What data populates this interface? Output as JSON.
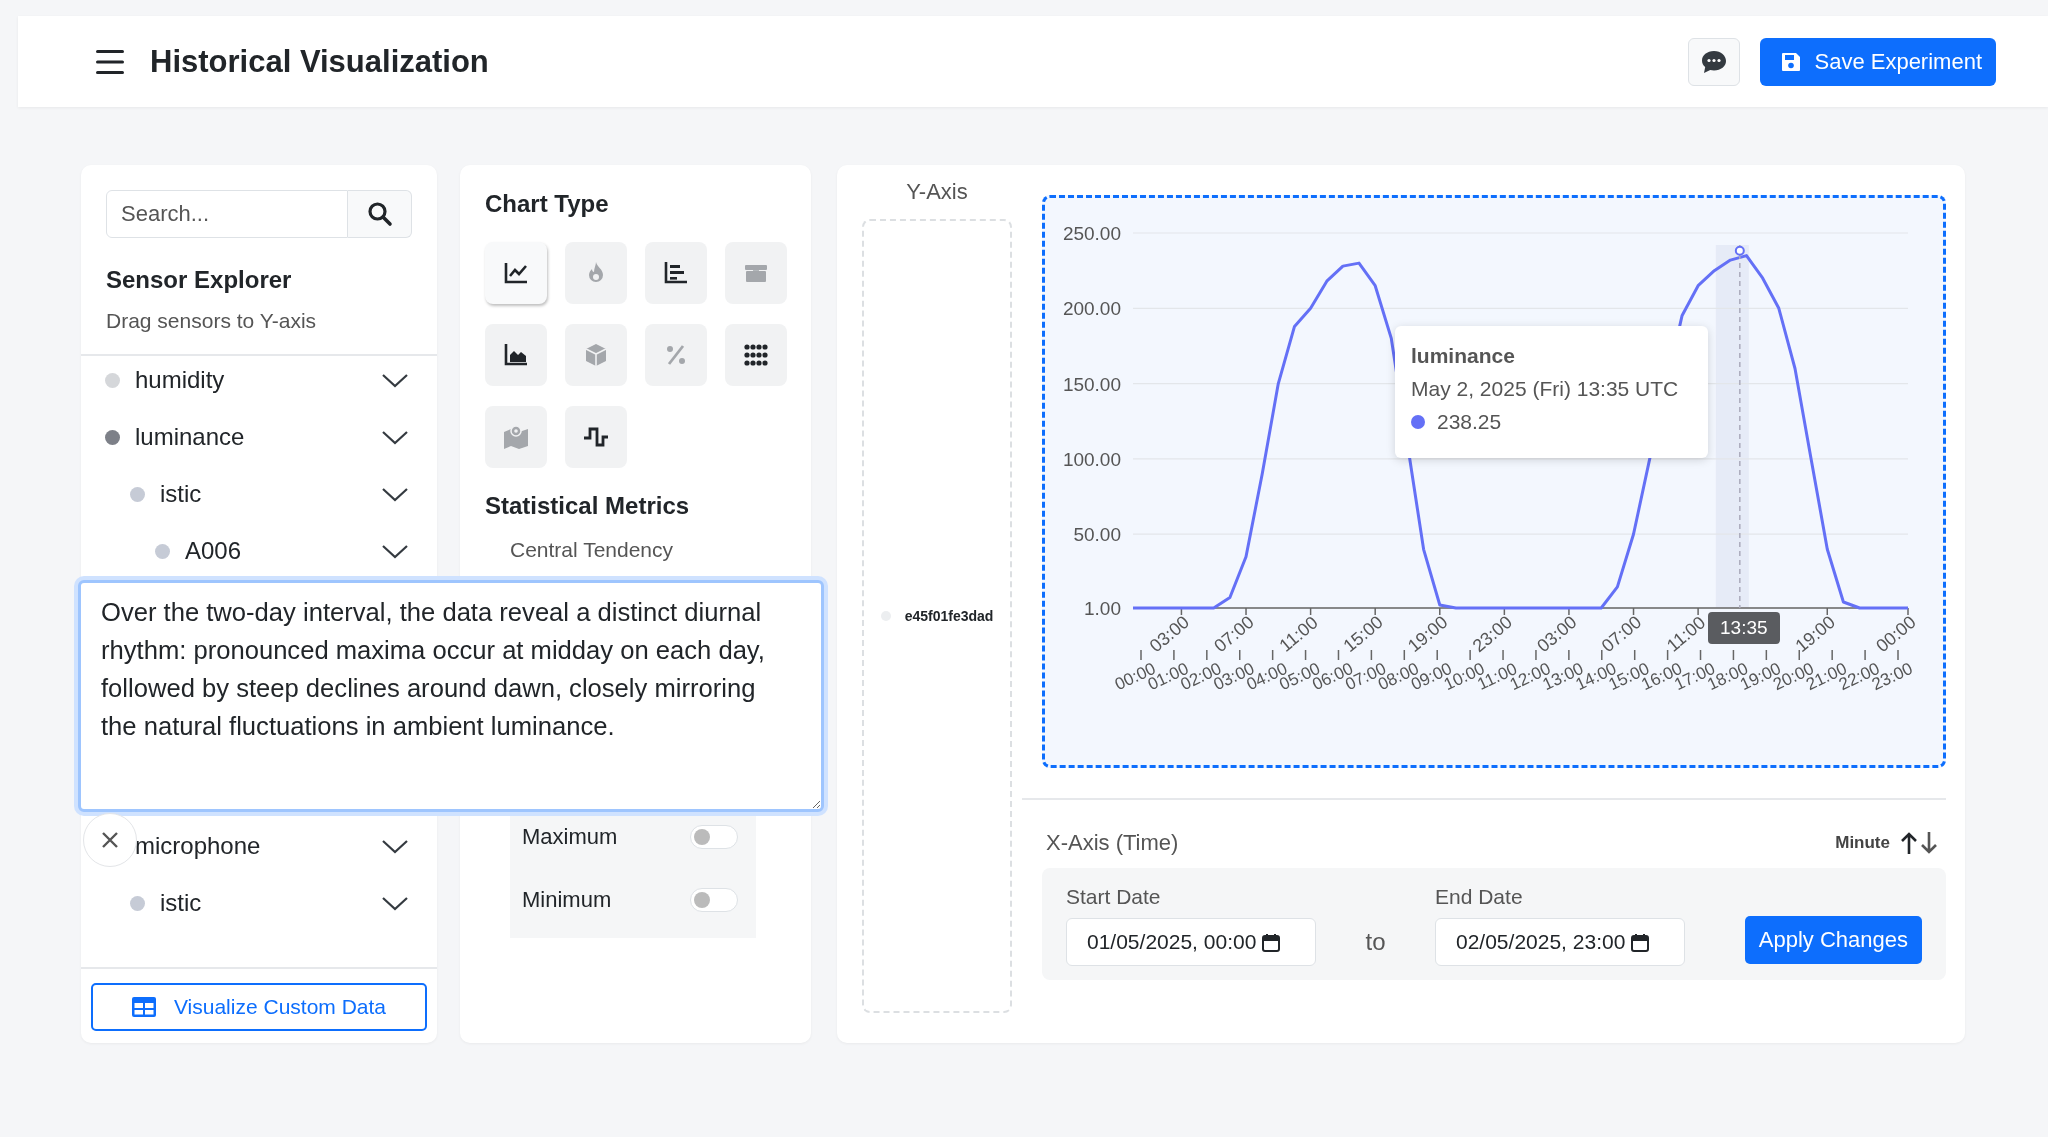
{
  "header": {
    "title": "Historical Visualization",
    "save_button": "Save Experiment"
  },
  "sensor_explorer": {
    "search": {
      "placeholder": "Search..."
    },
    "title": "Sensor Explorer",
    "subtitle": "Drag sensors to Y-axis",
    "tree": [
      {
        "label": "humidity",
        "selected": false
      },
      {
        "label": "luminance",
        "selected": true,
        "children": [
          {
            "label": "istic",
            "selected": false,
            "children": [
              {
                "label": "A006",
                "selected": false
              }
            ]
          }
        ]
      },
      {
        "label": "microphone",
        "children": [
          {
            "label": "istic",
            "selected": false
          }
        ]
      }
    ],
    "custom_button": "Visualize Custom Data"
  },
  "chart_types": {
    "title": "Chart Type",
    "options": [
      {
        "kind": "line",
        "selected": true,
        "disabled": false
      },
      {
        "kind": "flame",
        "selected": false,
        "disabled": true
      },
      {
        "kind": "bars",
        "selected": false,
        "disabled": false
      },
      {
        "kind": "box",
        "selected": false,
        "disabled": true
      },
      {
        "kind": "area",
        "selected": false,
        "disabled": false
      },
      {
        "kind": "cube",
        "selected": false,
        "disabled": true
      },
      {
        "kind": "percent",
        "selected": false,
        "disabled": true
      },
      {
        "kind": "dots",
        "selected": false,
        "disabled": false
      },
      {
        "kind": "map",
        "selected": false,
        "disabled": true
      },
      {
        "kind": "step",
        "selected": false,
        "disabled": false
      }
    ]
  },
  "statistical_metrics": {
    "title": "Statistical Metrics",
    "group": "Central Tendency",
    "toggles": [
      {
        "label": "Maximum",
        "on": false
      },
      {
        "label": "Minimum",
        "on": false
      }
    ]
  },
  "y_axis": {
    "title": "Y-Axis",
    "sensors": [
      {
        "label": "e45f01fe3dad"
      }
    ]
  },
  "chart": {
    "chart_data": {
      "type": "line",
      "x": [
        "2025-05-01T00:00",
        "2025-05-01T01:00",
        "2025-05-01T02:00",
        "2025-05-01T03:00",
        "2025-05-01T04:00",
        "2025-05-01T05:00",
        "2025-05-01T06:00",
        "2025-05-01T07:00",
        "2025-05-01T08:00",
        "2025-05-01T09:00",
        "2025-05-01T10:00",
        "2025-05-01T11:00",
        "2025-05-01T12:00",
        "2025-05-01T13:00",
        "2025-05-01T14:00",
        "2025-05-01T15:00",
        "2025-05-01T16:00",
        "2025-05-01T18:00",
        "2025-05-01T19:00",
        "2025-05-01T20:00",
        "2025-05-01T21:00",
        "2025-05-01T22:00",
        "2025-05-01T23:00",
        "2025-05-02T00:00",
        "2025-05-02T01:00",
        "2025-05-02T02:00",
        "2025-05-02T03:00",
        "2025-05-02T04:00",
        "2025-05-02T05:00",
        "2025-05-02T06:00",
        "2025-05-02T07:00",
        "2025-05-02T08:00",
        "2025-05-02T10:00",
        "2025-05-02T11:00",
        "2025-05-02T12:00",
        "2025-05-02T13:00",
        "2025-05-02T14:00",
        "2025-05-02T15:00",
        "2025-05-02T16:00",
        "2025-05-02T17:00",
        "2025-05-02T18:00",
        "2025-05-02T19:00",
        "2025-05-02T20:00",
        "2025-05-02T21:00",
        "2025-05-02T22:00",
        "2025-05-02T23:00",
        "2025-05-03T00:00"
      ],
      "series": [
        {
          "name": "luminance",
          "color": "#6470f6",
          "values": [
            1,
            1,
            1,
            1,
            1,
            1,
            8,
            35,
            90,
            150,
            188,
            200,
            218,
            228,
            230,
            215,
            180,
            40,
            3,
            1,
            1,
            1,
            1,
            1,
            1,
            1,
            1,
            1,
            1,
            15,
            50,
            100,
            195,
            215,
            225,
            232,
            235,
            220,
            200,
            160,
            100,
            40,
            5,
            1,
            1,
            1,
            1
          ]
        }
      ],
      "xlim": [
        "2025-05-01T00:00",
        "2025-05-03T00:00"
      ],
      "ylim": [
        1,
        250
      ],
      "grid": true,
      "xticks": [
        {
          "value": "2025-05-01T03:00",
          "label": "03:00"
        },
        {
          "value": "2025-05-01T07:00",
          "label": "07:00"
        },
        {
          "value": "2025-05-01T11:00",
          "label": "11:00"
        },
        {
          "value": "2025-05-01T15:00",
          "label": "15:00"
        },
        {
          "value": "2025-05-01T19:00",
          "label": "19:00"
        },
        {
          "value": "2025-05-01T23:00",
          "label": "23:00"
        },
        {
          "value": "2025-05-02T03:00",
          "label": "03:00"
        },
        {
          "value": "2025-05-02T07:00",
          "label": "07:00"
        },
        {
          "value": "2025-05-02T11:00",
          "label": "11:00"
        },
        {
          "value": "2025-05-02T19:00",
          "label": "19:00"
        },
        {
          "value": "2025-05-03T00:00",
          "label": "00:00"
        }
      ],
      "yticks": [
        {
          "value": 1,
          "label": "1.00"
        },
        {
          "value": 50,
          "label": "50.00"
        },
        {
          "value": 100,
          "label": "100.00"
        },
        {
          "value": 150,
          "label": "150.00"
        },
        {
          "value": 200,
          "label": "200.00"
        },
        {
          "value": 250,
          "label": "250.00"
        }
      ]
    },
    "lower_axis_labels": [
      "00:00",
      "01:00",
      "02:00",
      "03:00",
      "04:00",
      "05:00",
      "06:00",
      "07:00",
      "08:00",
      "09:00",
      "10:00",
      "11:00",
      "12:00",
      "13:00",
      "14:00",
      "15:00",
      "16:00",
      "17:00",
      "18:00",
      "19:00",
      "20:00",
      "21:00",
      "22:00",
      "23:00"
    ],
    "tooltip": {
      "time": "May 2, 2025 (Fri) 13:35 UTC",
      "value": "238.25",
      "color": "#6470f6"
    },
    "crosshair_label": "13:35"
  },
  "x_axis": {
    "title": "X-Axis (Time)",
    "resolution": "Minute",
    "start_label": "Start Date",
    "start_value": "01/05/2025, 00:00",
    "separator": "to",
    "end_label": "End Date",
    "end_value": "02/05/2025, 23:00",
    "apply_button": "Apply Changes"
  },
  "note": {
    "value": "Over the two-day interval, the data reveal a distinct diurnal rhythm: pronounced maxima occur at midday on each day, followed by steep declines around dawn, closely mirroring the natural fluctuations in ambient luminance."
  }
}
